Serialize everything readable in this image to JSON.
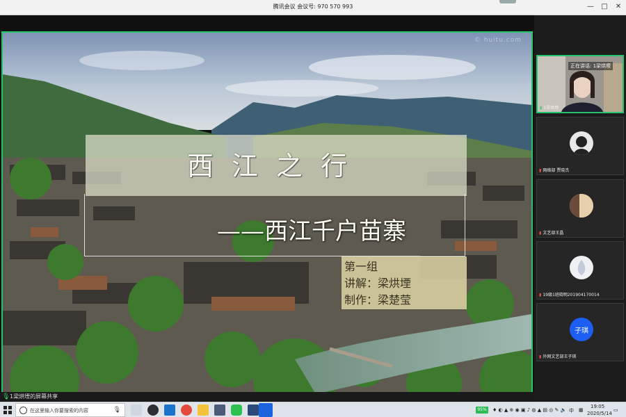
{
  "window": {
    "title": "腾讯会议 会议号: 970 570 993",
    "controls": {
      "minimize": "—",
      "maximize": "□",
      "close": "✕"
    }
  },
  "slide": {
    "watermark": "© huitu.com",
    "title": "西江之行",
    "subtitle": "——西江千户苗寨",
    "group": "第一组",
    "narrator": "讲解：梁烘堙",
    "producer": "制作：梁楚莹"
  },
  "share_status": {
    "icon": "mic-icon",
    "text": "1梁烘堙的屏幕共享"
  },
  "participants": [
    {
      "label": "1梁烘堙",
      "speaking_label": "正在讲话: 1梁烘堙",
      "active": true
    },
    {
      "label": "网络部 贾晓杰"
    },
    {
      "label": "文艺部王晶"
    },
    {
      "label": "19级1班晓明201904170014"
    },
    {
      "label": "外网文艺部王子琪",
      "avatar_text": "子琪"
    }
  ],
  "taskbar": {
    "search_placeholder": "在这里输入你要搜索的内容",
    "battery": "95%",
    "ime": "中",
    "time": "19:05",
    "date": "2020/5/14"
  },
  "colors": {
    "share_border": "#26c46a",
    "avatar_blue": "#1d5ff2"
  }
}
